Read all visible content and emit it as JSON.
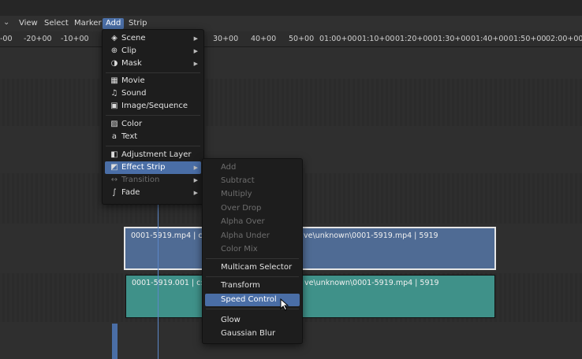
{
  "menubar": {
    "chevron": "⌄",
    "items": [
      "View",
      "Select",
      "Marker",
      "Add",
      "Strip"
    ],
    "active": "Add"
  },
  "ruler": {
    "ticks": [
      "-00",
      "-20+00",
      "-10+00",
      "30+00",
      "40+00",
      "50+00",
      "01:00+00",
      "01:10+00",
      "01:20+00",
      "01:30+00",
      "01:40+00",
      "01:50+00",
      "02:00+00"
    ]
  },
  "add_menu": {
    "items": [
      {
        "label": "Scene",
        "icon": "scene-icon",
        "submenu": true
      },
      {
        "label": "Clip",
        "icon": "clip-icon",
        "submenu": true
      },
      {
        "label": "Mask",
        "icon": "mask-icon",
        "submenu": true
      },
      {
        "label": "Movie",
        "icon": "movie-icon",
        "submenu": false
      },
      {
        "label": "Sound",
        "icon": "sound-icon",
        "submenu": false
      },
      {
        "label": "Image/Sequence",
        "icon": "image-icon",
        "submenu": false
      },
      {
        "label": "Color",
        "icon": "color-icon",
        "submenu": false
      },
      {
        "label": "Text",
        "icon": "text-icon",
        "submenu": false
      },
      {
        "label": "Adjustment Layer",
        "icon": "adjustment-layer-icon",
        "submenu": false
      },
      {
        "label": "Effect Strip",
        "icon": "effect-strip-icon",
        "submenu": true,
        "highlighted": true
      },
      {
        "label": "Transition",
        "icon": "transition-icon",
        "submenu": true,
        "disabled": true
      },
      {
        "label": "Fade",
        "icon": "fade-icon",
        "submenu": true
      }
    ]
  },
  "effect_menu": {
    "items": [
      {
        "label": "Add",
        "disabled": true
      },
      {
        "label": "Subtract",
        "disabled": true
      },
      {
        "label": "Multiply",
        "disabled": true
      },
      {
        "label": "Over Drop",
        "disabled": true
      },
      {
        "label": "Alpha Over",
        "disabled": true
      },
      {
        "label": "Alpha Under",
        "disabled": true
      },
      {
        "label": "Color Mix",
        "disabled": true
      },
      {
        "label": "Multicam Selector",
        "disabled": false
      },
      {
        "label": "Transform",
        "disabled": false
      },
      {
        "label": "Speed Control",
        "disabled": false,
        "highlighted": true
      },
      {
        "label": "Glow",
        "disabled": false
      },
      {
        "label": "Gaussian Blur",
        "disabled": false
      }
    ]
  },
  "strips": {
    "movie": {
      "label": "0001-5919.mp4 | c:\\U",
      "label_tail": "ve\\unknown\\0001-5919.mp4 | 5919"
    },
    "teal": {
      "label": "0001-5919.001 | c:\\U",
      "label_tail": "ve\\unknown\\0001-5919.mp4 | 5919"
    }
  },
  "colors": {
    "accent": "#4a6ea6",
    "movie_strip": "#4f6b94",
    "meta_strip": "#3f9189",
    "background": "#262626"
  }
}
